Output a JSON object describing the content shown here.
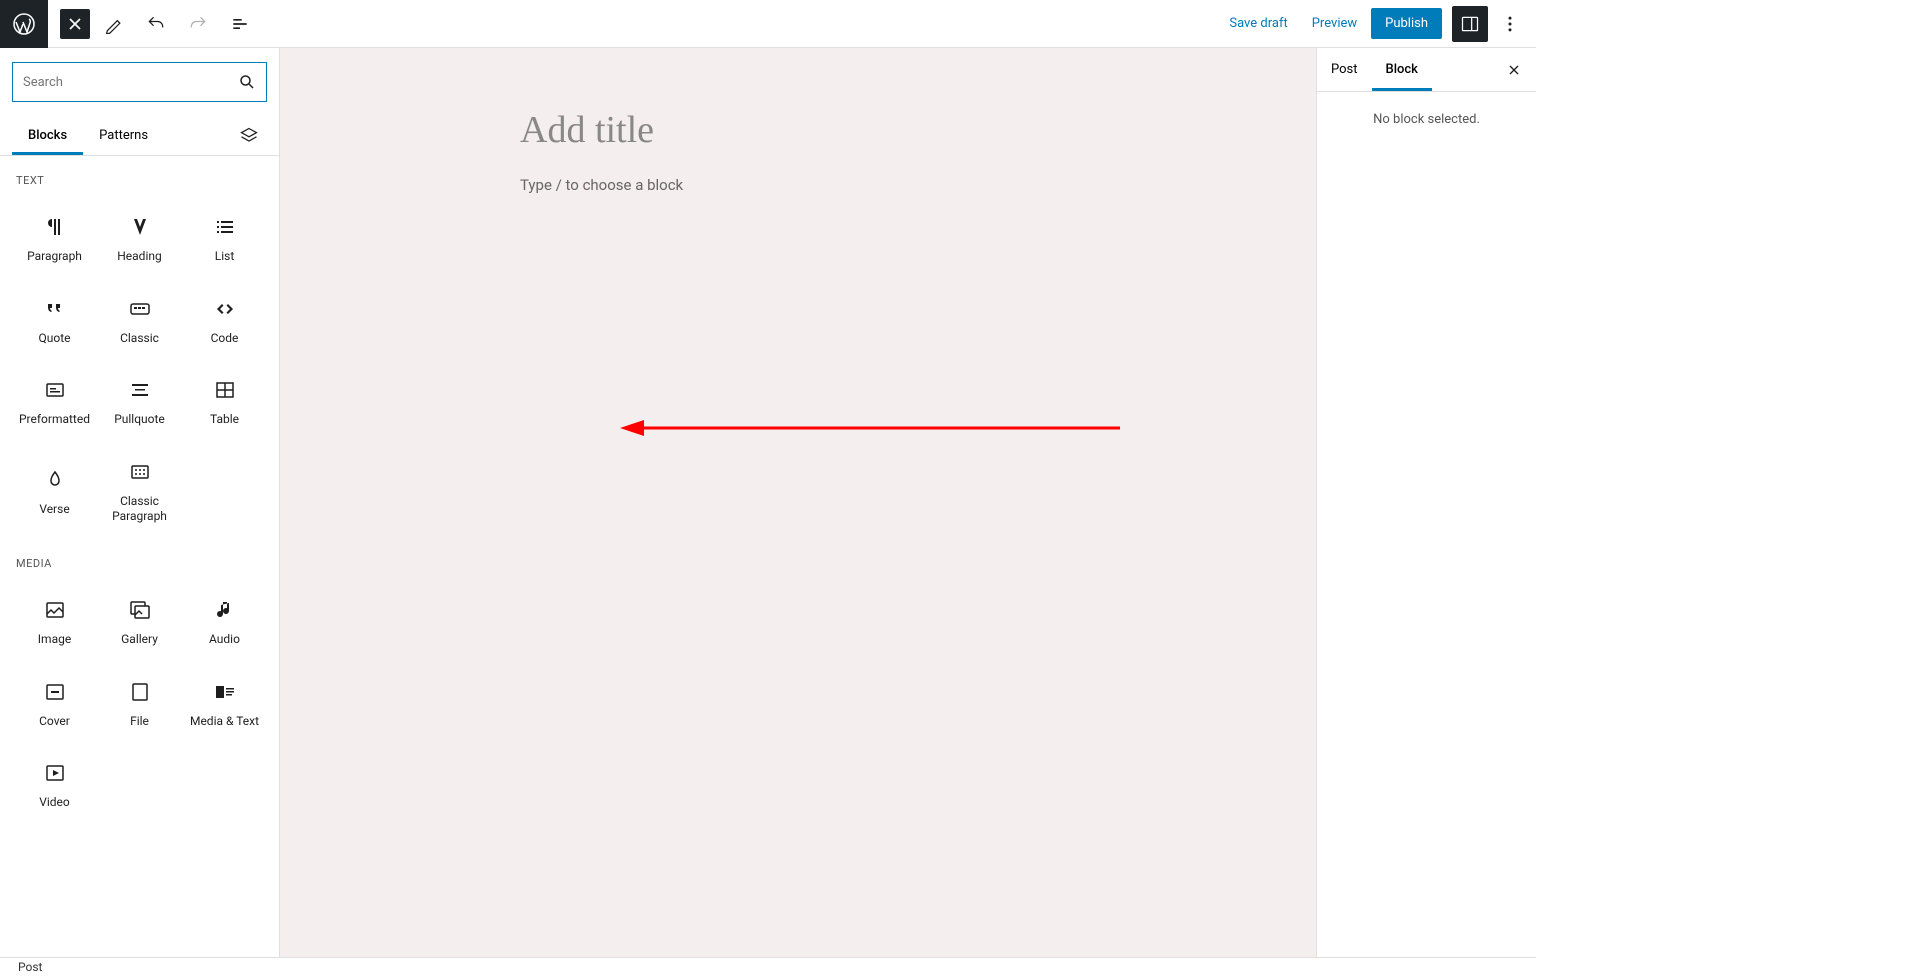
{
  "topbar": {
    "save_draft": "Save draft",
    "preview": "Preview",
    "publish": "Publish"
  },
  "inserter": {
    "search_placeholder": "Search",
    "tabs": {
      "blocks": "Blocks",
      "patterns": "Patterns"
    },
    "categories": [
      {
        "name": "TEXT",
        "items": [
          {
            "label": "Paragraph",
            "icon": "paragraph"
          },
          {
            "label": "Heading",
            "icon": "heading"
          },
          {
            "label": "List",
            "icon": "list"
          },
          {
            "label": "Quote",
            "icon": "quote"
          },
          {
            "label": "Classic",
            "icon": "classic"
          },
          {
            "label": "Code",
            "icon": "code"
          },
          {
            "label": "Preformatted",
            "icon": "preformatted"
          },
          {
            "label": "Pullquote",
            "icon": "pullquote"
          },
          {
            "label": "Table",
            "icon": "table"
          },
          {
            "label": "Verse",
            "icon": "verse"
          },
          {
            "label": "Classic Paragraph",
            "icon": "classic-paragraph"
          }
        ]
      },
      {
        "name": "MEDIA",
        "items": [
          {
            "label": "Image",
            "icon": "image"
          },
          {
            "label": "Gallery",
            "icon": "gallery"
          },
          {
            "label": "Audio",
            "icon": "audio"
          },
          {
            "label": "Cover",
            "icon": "cover"
          },
          {
            "label": "File",
            "icon": "file"
          },
          {
            "label": "Media & Text",
            "icon": "media-text"
          },
          {
            "label": "Video",
            "icon": "video"
          }
        ]
      }
    ]
  },
  "canvas": {
    "title_placeholder": "Add title",
    "body_placeholder": "Type / to choose a block"
  },
  "sidebar": {
    "tabs": {
      "post": "Post",
      "block": "Block"
    },
    "no_block": "No block selected."
  },
  "footer": {
    "status": "Post"
  }
}
